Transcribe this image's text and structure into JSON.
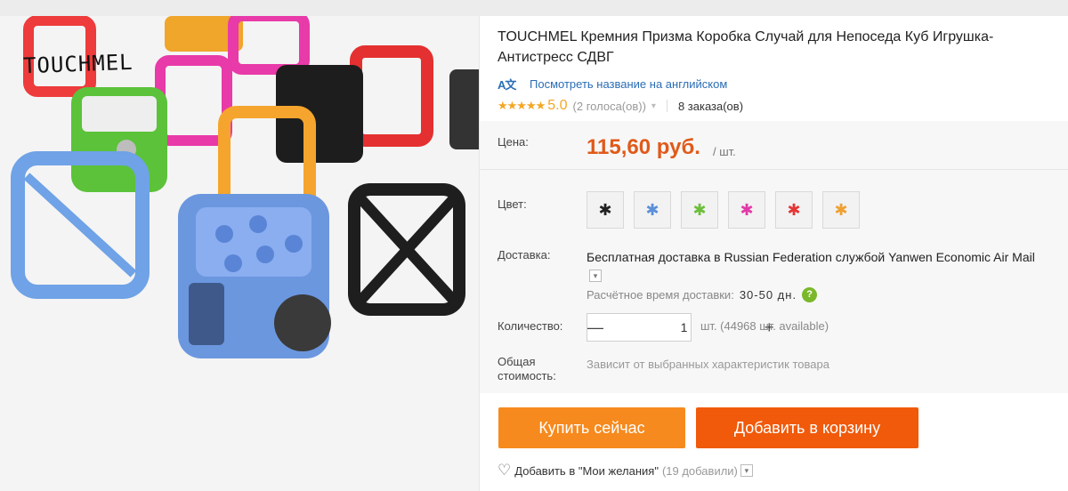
{
  "product": {
    "watermark": "TOUCHMEL",
    "title": "TOUCHMEL Кремния Призма Коробка Случай для Непоседа Куб Игрушка-Антистресс СДВГ",
    "translate_link": "Посмотреть название на английском",
    "translate_icon": "translate-icon",
    "rating": {
      "stars": "★★★★★",
      "value": "5.0",
      "votes": "(2 голоса(ов))",
      "orders": "8 заказа(ов)"
    }
  },
  "price": {
    "label": "Цена:",
    "value": "115,60 руб.",
    "unit": "/ шт."
  },
  "color": {
    "label": "Цвет:",
    "options": [
      {
        "name": "black",
        "icon": "cube-icon",
        "hex": "#222222"
      },
      {
        "name": "blue",
        "icon": "cube-icon",
        "hex": "#5b8fd8"
      },
      {
        "name": "green",
        "icon": "cube-icon",
        "hex": "#6cbf3a"
      },
      {
        "name": "pink",
        "icon": "cube-icon",
        "hex": "#e23aa8"
      },
      {
        "name": "red",
        "icon": "cube-icon",
        "hex": "#e53535"
      },
      {
        "name": "orange",
        "icon": "cube-icon",
        "hex": "#f0a030"
      }
    ]
  },
  "delivery": {
    "label": "Доставка:",
    "text": "Бесплатная доставка в Russian Federation службой Yanwen Economic Air Mail",
    "eta_label": "Расчётное время доставки:",
    "eta_value": "30-50 дн."
  },
  "quantity": {
    "label": "Количество:",
    "value": "1",
    "minus": "—",
    "plus": "+",
    "available": "шт. (44968 шт. available)"
  },
  "total": {
    "label": "Общая стоимость:",
    "value": "Зависит от выбранных характеристик товара"
  },
  "actions": {
    "buy_now": "Купить сейчас",
    "add_to_cart": "Добавить в корзину"
  },
  "wishlist": {
    "label": "Добавить в \"Мои желания\"",
    "count": "(19 добавили)"
  },
  "colors": {
    "price": "#e05a1a",
    "buy": "#f68a1e",
    "cart": "#f05a0a",
    "link": "#2a6db5",
    "star": "#f5a623"
  }
}
